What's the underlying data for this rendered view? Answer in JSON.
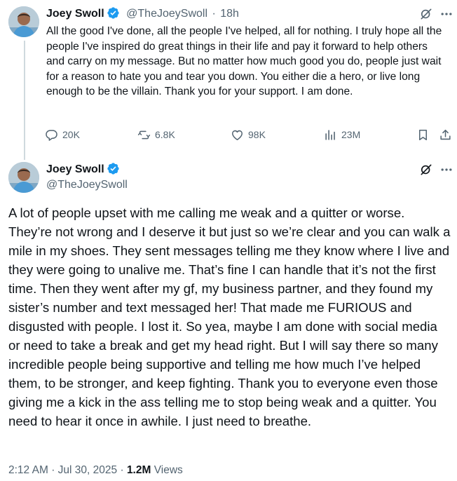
{
  "tweet1": {
    "author_name": "Joey Swoll",
    "author_handle": "@TheJoeySwoll",
    "separator": "·",
    "time": "18h",
    "text": "All the good I've done, all the people I've helped, all for nothing. I truly hope all the people I've inspired do great things in their life and pay it forward to help others and carry on my message. But no matter how much good you do, people just wait for a reason to hate you and tear you down. You either die a hero, or live long enough to be the villain. Thank you for your support. I am done.",
    "replies": "20K",
    "reposts": "6.8K",
    "likes": "98K",
    "views": "23M"
  },
  "tweet2": {
    "author_name": "Joey Swoll",
    "author_handle": "@TheJoeySwoll",
    "text": "A lot of people upset with me calling me weak and a quitter or worse. They’re not wrong and I deserve it but just so we’re clear and you can walk a mile in my shoes. They sent messages telling me they know where I live and they were going to unalive me. That’s fine I can handle that it’s not the first time. Then they went after my gf, my business partner, and they found my sister’s number and text messaged her! That made me FURIOUS and disgusted with people. I lost it. So yea, maybe I am done with social media or need to take a break and get my head right. But I will say there so many incredible people being supportive and telling me how much I’ve helped them, to be stronger, and keep fighting. Thank you to everyone even those giving me a kick in the ass telling me to stop being weak and a quitter. You need to hear it once in awhile. I just need to breathe.",
    "time": "2:12 AM",
    "date": "Jul 30, 2025",
    "separator": "·",
    "views_count": "1.2M",
    "views_label": "Views"
  },
  "icons": {
    "verified": "verified-badge-icon",
    "grok": "grok-icon",
    "more": "more-icon",
    "reply": "reply-icon",
    "repost": "repost-icon",
    "like": "like-icon",
    "views": "views-icon",
    "bookmark": "bookmark-icon",
    "share": "share-icon"
  },
  "colors": {
    "verified": "#1d9bf0",
    "text": "#0f1419",
    "secondary": "#536471",
    "divider": "#cfd9de"
  }
}
